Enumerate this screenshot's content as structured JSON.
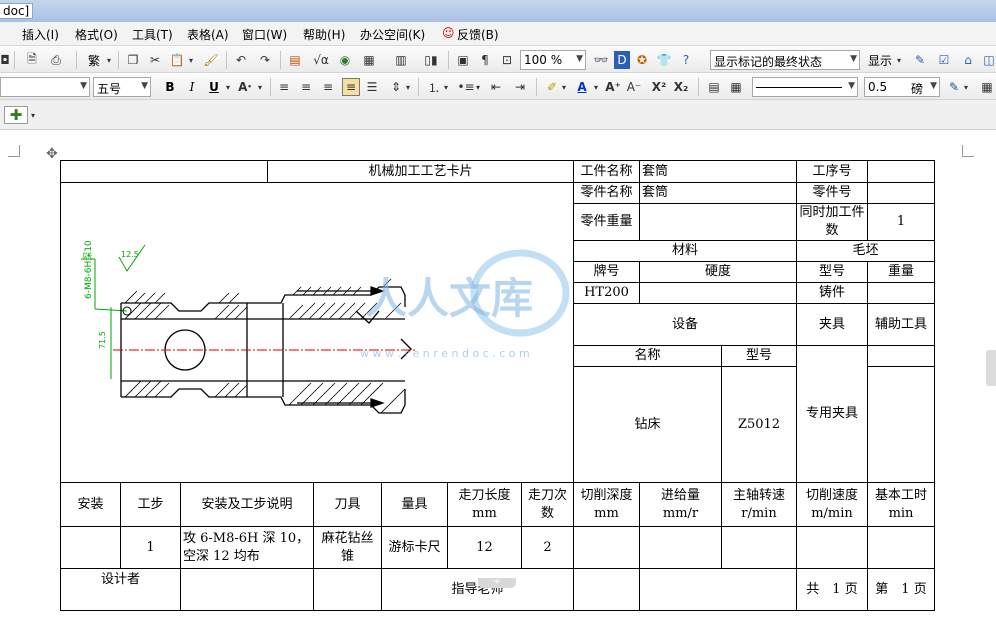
{
  "window": {
    "title_fragment": "doc]"
  },
  "menu": [
    {
      "label": "插入(I)"
    },
    {
      "label": "格式(O)"
    },
    {
      "label": "工具(T)"
    },
    {
      "label": "表格(A)"
    },
    {
      "label": "窗口(W)"
    },
    {
      "label": "帮助(H)"
    },
    {
      "label": "办公空间(K)"
    },
    {
      "label": "反馈(B)"
    }
  ],
  "toolbar": {
    "traditional_label": "繁",
    "zoom_value": "100 %",
    "markup_mode": "显示标记的最终状态",
    "show_label": "显示"
  },
  "format_bar": {
    "font_size": "五号",
    "bold": "B",
    "italic": "I",
    "underline": "U",
    "line_weight": "0.5",
    "unit": "磅"
  },
  "watermark": {
    "text": "人人文库",
    "url": "w w w . r e n r e n d o c . c o m"
  },
  "card": {
    "title": "机械加工工艺卡片",
    "workpiece_name_label": "工件名称",
    "workpiece_name": "套筒",
    "process_no_label": "工序号",
    "part_name_label": "零件名称",
    "part_name": "套筒",
    "part_no_label": "零件号",
    "part_weight_label": "零件重量",
    "simul_count_label": "同时加工件数",
    "simul_count": "1",
    "material_label": "材料",
    "blank_label": "毛坯",
    "grade_label": "牌号",
    "hardness_label": "硬度",
    "type_label": "型号",
    "weight_label": "重量",
    "grade": "HT200",
    "blank_type": "铸件",
    "equipment_label": "设备",
    "fixture_label": "夹具",
    "aux_tool_label": "辅助工具",
    "name_label": "名称",
    "model_label": "型号",
    "machine": "钻床",
    "machine_model": "Z5012",
    "fixture": "专用夹具",
    "headers": [
      "安装",
      "工步",
      "安装及工步说明",
      "刀具",
      "量具",
      "走刀长度 mm",
      "走刀次数",
      "切削深度 mm",
      "进给量 mm/r",
      "主轴转速 r/min",
      "切削速度 m/min",
      "基本工时 min"
    ],
    "row": {
      "install": "",
      "step": "1",
      "desc": "攻 6-M8-6H 深 10，空深 12 均布",
      "tool": "麻花钻丝锥",
      "gauge": "游标卡尺",
      "feed_len": "12",
      "feed_times": "2"
    },
    "designer_label": "设计者",
    "advisor_label": "指导老师",
    "total_pages": "共　1 页",
    "page_no": "第　1 页"
  },
  "drawing": {
    "callout_green": "6-M8-6H深10",
    "roughness": "12.5",
    "dim_left": "71.5"
  }
}
